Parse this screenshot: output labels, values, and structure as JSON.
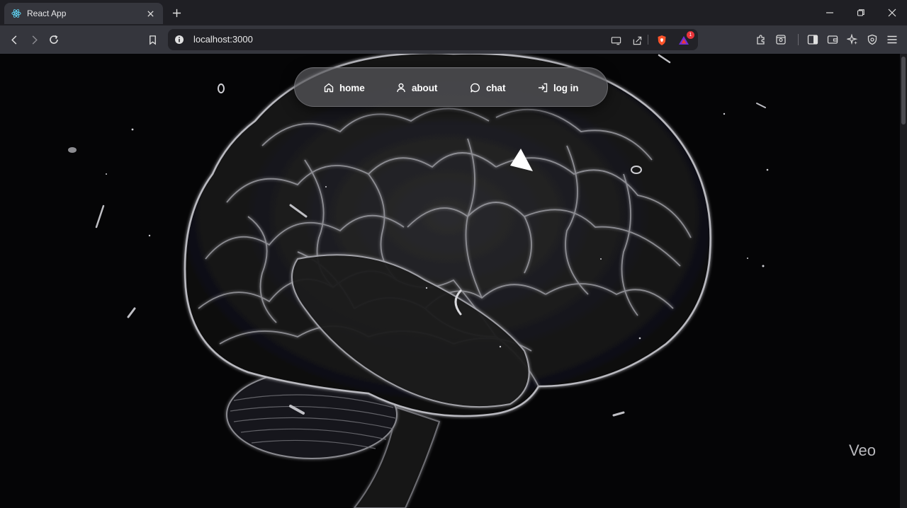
{
  "browser": {
    "tab": {
      "title": "React App",
      "favicon": "react-atom-icon"
    },
    "address_bar": {
      "url": "localhost:3000"
    },
    "extension_badge_count": "1",
    "colors": {
      "brave_orange": "#fb542b",
      "badge_red": "#e8343b",
      "react_cyan": "#61dafb"
    }
  },
  "nav": {
    "items": [
      {
        "label": "home",
        "icon": "home-icon"
      },
      {
        "label": "about",
        "icon": "user-icon"
      },
      {
        "label": "chat",
        "icon": "chat-bubble-icon"
      },
      {
        "label": "log in",
        "icon": "login-icon"
      }
    ]
  },
  "hero": {
    "image": "brain-illustration",
    "watermark": "Veo"
  }
}
